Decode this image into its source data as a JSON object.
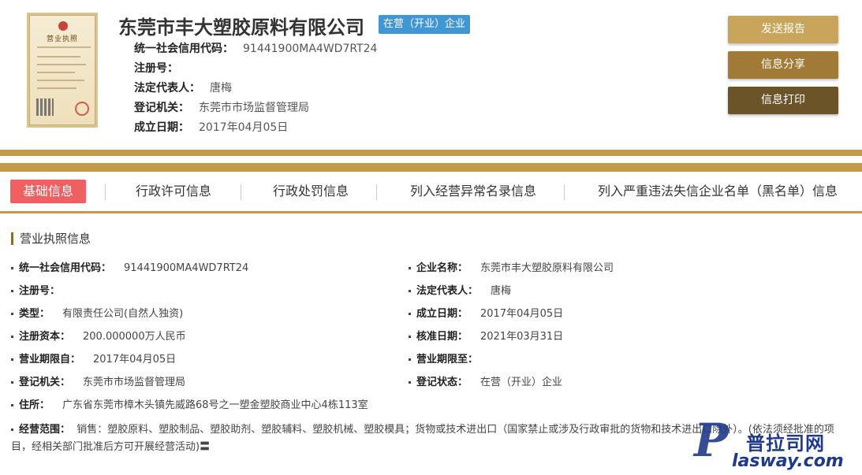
{
  "header": {
    "license_title": "营业执照",
    "company_name": "东莞市丰大塑胶原料有限公司",
    "status_tag": "在营（开业）企业",
    "rows": [
      {
        "key": "统一社会信用代码：",
        "value": "91441900MA4WD7RT24"
      },
      {
        "key": "注册号：",
        "value": ""
      },
      {
        "key": "法定代表人：",
        "value": "唐梅"
      },
      {
        "key": "登记机关：",
        "value": "东莞市市场监督管理局"
      },
      {
        "key": "成立日期：",
        "value": "2017年04月05日"
      }
    ],
    "buttons": {
      "report": "发送报告",
      "share": "信息分享",
      "print": "信息打印"
    }
  },
  "tabs": [
    "基础信息",
    "行政许可信息",
    "行政处罚信息",
    "列入经营异常名录信息",
    "列入严重违法失信企业名单（黑名单）信息"
  ],
  "section": {
    "title": "营业执照信息",
    "left": [
      {
        "key": "统一社会信用代码：",
        "value": "91441900MA4WD7RT24"
      },
      {
        "key": "注册号：",
        "value": ""
      },
      {
        "key": "类型：",
        "value": "有限责任公司(自然人独资)"
      },
      {
        "key": "注册资本：",
        "value": "200.000000万人民币"
      },
      {
        "key": "营业期限自：",
        "value": "2017年04月05日"
      },
      {
        "key": "登记机关：",
        "value": "东莞市市场监督管理局"
      },
      {
        "key": "住所：",
        "value": "广东省东莞市樟木头镇先威路68号之一塑金塑胶商业中心4栋113室"
      }
    ],
    "right": [
      {
        "key": "企业名称：",
        "value": "东莞市丰大塑胶原料有限公司"
      },
      {
        "key": "法定代表人：",
        "value": "唐梅"
      },
      {
        "key": "成立日期：",
        "value": "2017年04月05日"
      },
      {
        "key": "核准日期：",
        "value": "2021年03月31日"
      },
      {
        "key": "营业期限至：",
        "value": ""
      },
      {
        "key": "登记状态：",
        "value": "在营（开业）企业"
      }
    ],
    "scope": {
      "key": "经营范围：",
      "value": "销售：塑胶原料、塑胶制品、塑胶助剂、塑胶辅料、塑胶机械、塑胶模具；货物或技术进出口（国家禁止或涉及行政审批的货物和技术进出口除外）。(依法须经批准的项目，经相关部门批准后方可开展经营活动)〓"
    }
  },
  "watermark": {
    "cn": "普拉司网",
    "en": "lasway.com"
  },
  "colors": {
    "gold": "#c29a4a",
    "tab_active": "#f06060",
    "status_tag": "#4196d6"
  }
}
